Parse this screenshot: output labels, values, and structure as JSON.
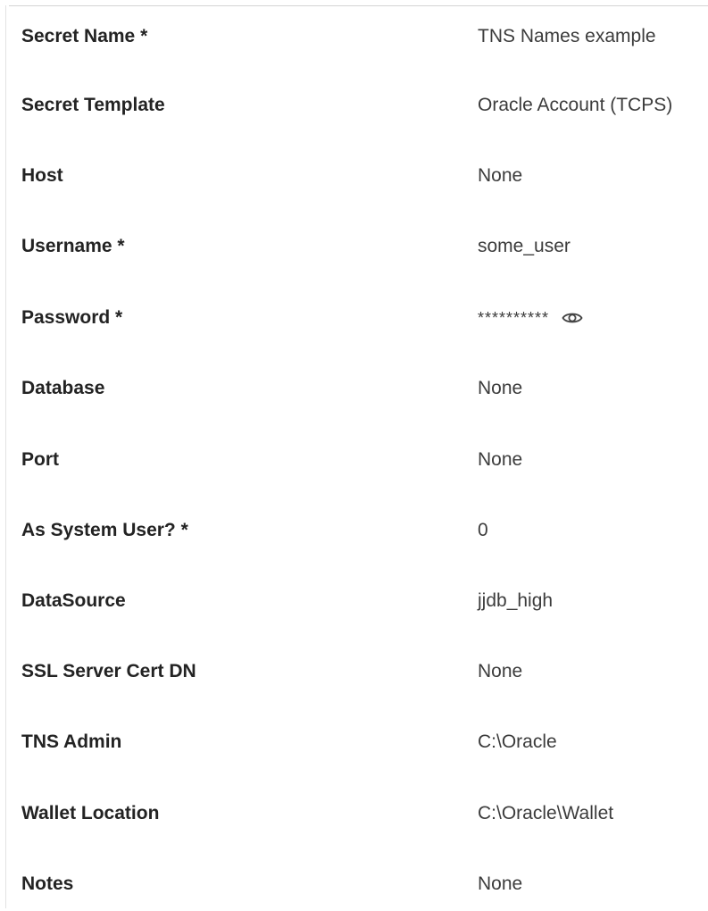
{
  "fields": [
    {
      "label": "Secret Name *",
      "value": "TNS Names example"
    },
    {
      "label": "Secret Template",
      "value": "Oracle Account (TCPS)"
    },
    {
      "label": "Host",
      "value": "None"
    },
    {
      "label": "Username *",
      "value": "some_user"
    },
    {
      "label": "Password *",
      "value": "**********",
      "icon": "eye-icon"
    },
    {
      "label": "Database",
      "value": "None"
    },
    {
      "label": "Port",
      "value": "None"
    },
    {
      "label": "As System User? *",
      "value": "0"
    },
    {
      "label": "DataSource",
      "value": "jjdb_high"
    },
    {
      "label": "SSL Server Cert DN",
      "value": "None"
    },
    {
      "label": "TNS Admin",
      "value": "C:\\Oracle"
    },
    {
      "label": "Wallet Location",
      "value": "C:\\Oracle\\Wallet"
    },
    {
      "label": "Notes",
      "value": "None"
    }
  ]
}
